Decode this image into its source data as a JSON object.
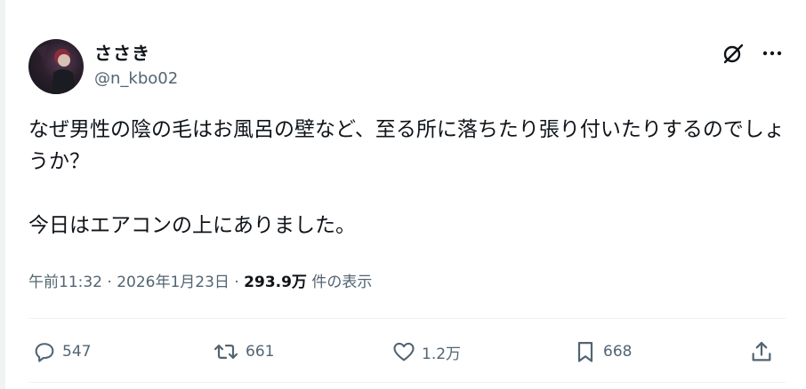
{
  "author": {
    "display_name": "ささき",
    "handle": "@n_kbo02"
  },
  "post": {
    "text": "なぜ男性の陰の毛はお風呂の壁など、至る所に落ちたり張り付いたりするのでしょうか？\n\n今日はエアコンの上にありました。"
  },
  "meta": {
    "time": "午前11:32",
    "separator": "·",
    "date": "2026年1月23日",
    "views_count": "293.9万",
    "views_label": "件の表示"
  },
  "actions": {
    "replies": "547",
    "reposts": "661",
    "likes": "1.2万",
    "bookmarks": "668"
  },
  "icons": {
    "grok": "grok-icon",
    "more": "more-icon",
    "reply": "reply-icon",
    "repost": "repost-icon",
    "like": "heart-icon",
    "bookmark": "bookmark-icon",
    "share": "share-icon"
  },
  "colors": {
    "text": "#0f1419",
    "secondary": "#536471",
    "divider": "#eff3f4"
  }
}
